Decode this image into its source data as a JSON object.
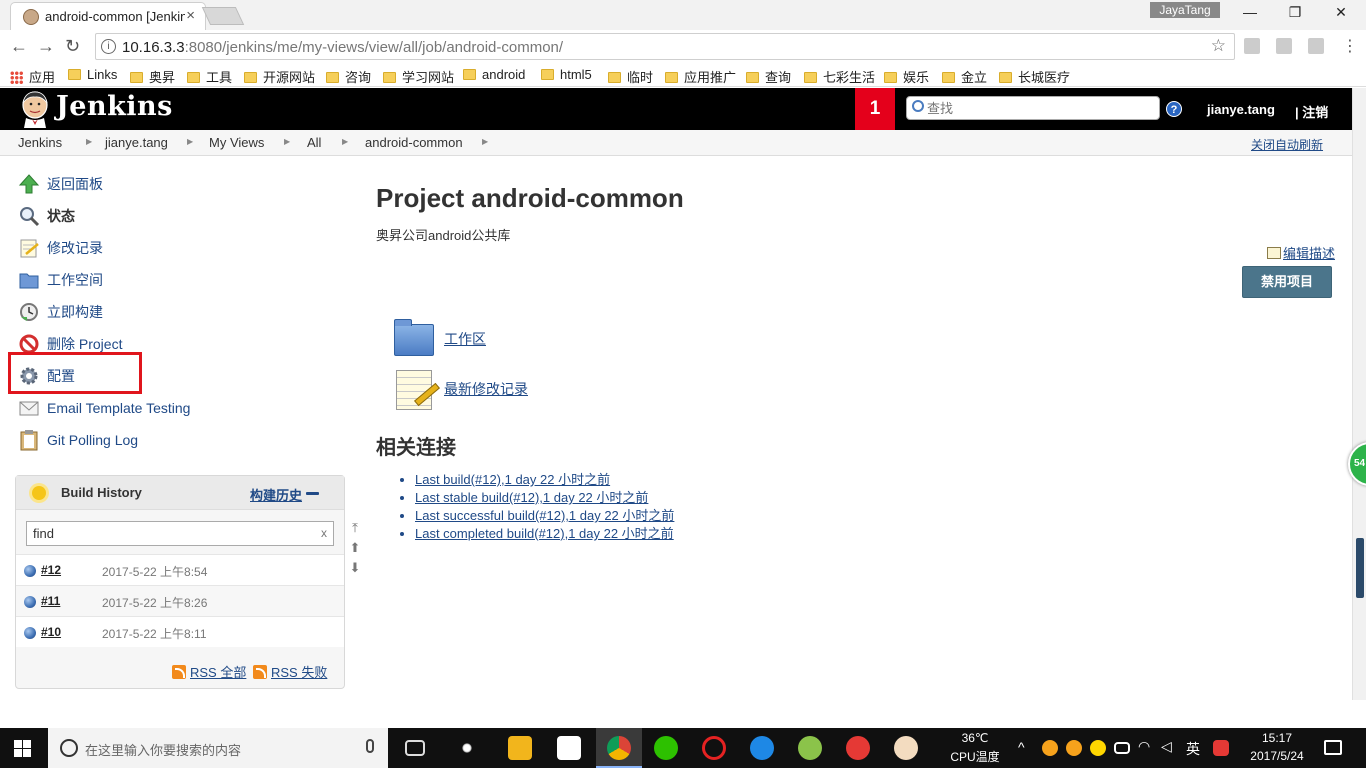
{
  "browser": {
    "tab_title": "android-common [Jenkins]",
    "tab_close": "×",
    "profile_name": "JayaTang",
    "window_min": "—",
    "window_max": "❐",
    "window_close": "✕",
    "back": "←",
    "forward": "→",
    "reload": "↻",
    "url_host": "10.16.3.3",
    "url_rest": ":8080/jenkins/me/my-views/view/all/job/android-common/",
    "bookmarks": [
      "应用",
      "Links",
      "奥昇",
      "工具",
      "开源网站",
      "咨询",
      "学习网站",
      "android",
      "html5",
      "临时",
      "应用推广",
      "查询",
      "七彩生活",
      "娱乐",
      "金立",
      "长城医疗"
    ]
  },
  "header": {
    "brand": "Jenkins",
    "notification_count": "1",
    "search_placeholder": "查找",
    "help": "?",
    "username": "jianye.tang",
    "logout": "| 注销"
  },
  "breadcrumbs": {
    "items": [
      "Jenkins",
      "jianye.tang",
      "My Views",
      "All",
      "android-common"
    ],
    "auto_refresh": "关闭自动刷新"
  },
  "sidebar": {
    "tasks": [
      {
        "label": "返回面板",
        "icon": "up-arrow-icon"
      },
      {
        "label": "状态",
        "icon": "magnifier-icon"
      },
      {
        "label": "修改记录",
        "icon": "notepad-icon"
      },
      {
        "label": "工作空间",
        "icon": "folder-icon"
      },
      {
        "label": "立即构建",
        "icon": "build-clock-icon"
      },
      {
        "label": "删除 Project",
        "icon": "no-entry-icon"
      },
      {
        "label": "配置",
        "icon": "gear-icon"
      },
      {
        "label": "Email Template Testing",
        "icon": "envelope-icon"
      },
      {
        "label": "Git Polling Log",
        "icon": "clipboard-icon"
      }
    ],
    "build_history": {
      "title": "Build History",
      "trend": "构建历史",
      "find_value": "find",
      "clear": "x",
      "builds": [
        {
          "number": "#12",
          "date": "2017-5-22 上午8:54"
        },
        {
          "number": "#11",
          "date": "2017-5-22 上午8:26"
        },
        {
          "number": "#10",
          "date": "2017-5-22 上午8:11"
        }
      ],
      "rss_all": "RSS 全部",
      "rss_failed": "RSS 失败"
    }
  },
  "main": {
    "title": "Project android-common",
    "description": "奥昇公司android公共库",
    "edit_description": "编辑描述",
    "disable_button": "禁用项目",
    "workspace_link": "工作区",
    "changes_link": "最新修改记录",
    "related_heading": "相关连接",
    "related_links": [
      "Last build(#12),1 day 22 小时之前",
      "Last stable build(#12),1 day 22 小时之前",
      "Last successful build(#12),1 day 22 小时之前",
      "Last completed build(#12),1 day 22 小时之前"
    ]
  },
  "float_badge": "54",
  "taskbar": {
    "search_placeholder": "在这里输入你要搜索的内容",
    "temperature": "36℃",
    "cpu_label": "CPU温度",
    "ime": "英",
    "time": "15:17",
    "date": "2017/5/24"
  }
}
